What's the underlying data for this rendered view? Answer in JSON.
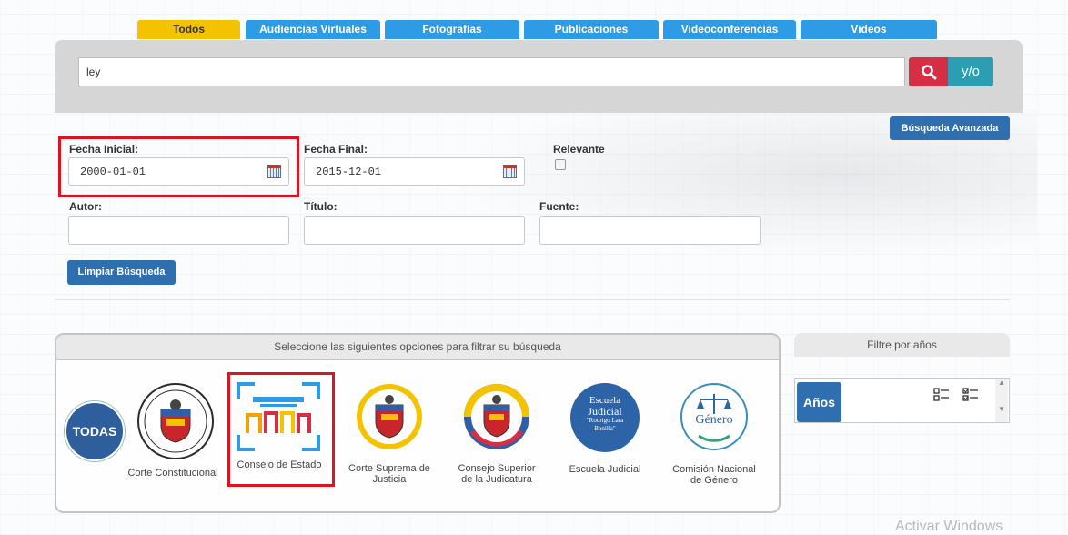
{
  "tabs": [
    {
      "label": "Todos",
      "active": true
    },
    {
      "label": "Audiencias Virtuales",
      "active": false
    },
    {
      "label": "Fotografías",
      "active": false
    },
    {
      "label": "Publicaciones",
      "active": false
    },
    {
      "label": "Videoconferencias",
      "active": false
    },
    {
      "label": "Videos",
      "active": false
    }
  ],
  "search": {
    "value": "ley",
    "search_icon": "search-icon",
    "yo_label": "y/o"
  },
  "advanced_button": "Búsqueda Avanzada",
  "filters": {
    "fecha_inicial": {
      "label": "Fecha Inicial:",
      "value": "2000-01-01"
    },
    "fecha_final": {
      "label": "Fecha Final:",
      "value": "2015-12-01"
    },
    "relevante": {
      "label": "Relevante",
      "checked": false
    },
    "autor": {
      "label": "Autor:",
      "value": ""
    },
    "titulo": {
      "label": "Título:",
      "value": ""
    },
    "fuente": {
      "label": "Fuente:",
      "value": ""
    },
    "clear_button": "Limpiar Búsqueda"
  },
  "corporations": {
    "header": "Seleccione las siguientes opciones para filtrar su búsqueda",
    "items": [
      {
        "label": "TODAS",
        "icon": "todas-badge"
      },
      {
        "label": "Corte Constitucional",
        "icon": "colombia-seal-icon"
      },
      {
        "label": "Consejo de Estado",
        "icon": "consejo-estado-logo"
      },
      {
        "label": "Corte Suprema de Justicia",
        "icon": "colombia-coat-of-arms-icon"
      },
      {
        "label": "Consejo Superior de la Judicatura",
        "icon": "colombia-coat-of-arms-icon"
      },
      {
        "label": "Escuela Judicial",
        "icon": "escuela-judicial-logo"
      },
      {
        "label": "Comisión Nacional de Género",
        "icon": "genero-logo"
      }
    ],
    "escuela_logo_text": [
      "Escuela",
      "Judicial",
      "\"Rodrigo Lara",
      "Bonilla\""
    ],
    "genero_logo_text": "Género"
  },
  "years": {
    "header": "Filtre por años",
    "button": "Años"
  },
  "watermark": "Activar Windows",
  "colors": {
    "accent": "#2e9be6",
    "active_tab": "#f5c200",
    "danger": "#d62e44",
    "highlight": "#e0121f"
  }
}
